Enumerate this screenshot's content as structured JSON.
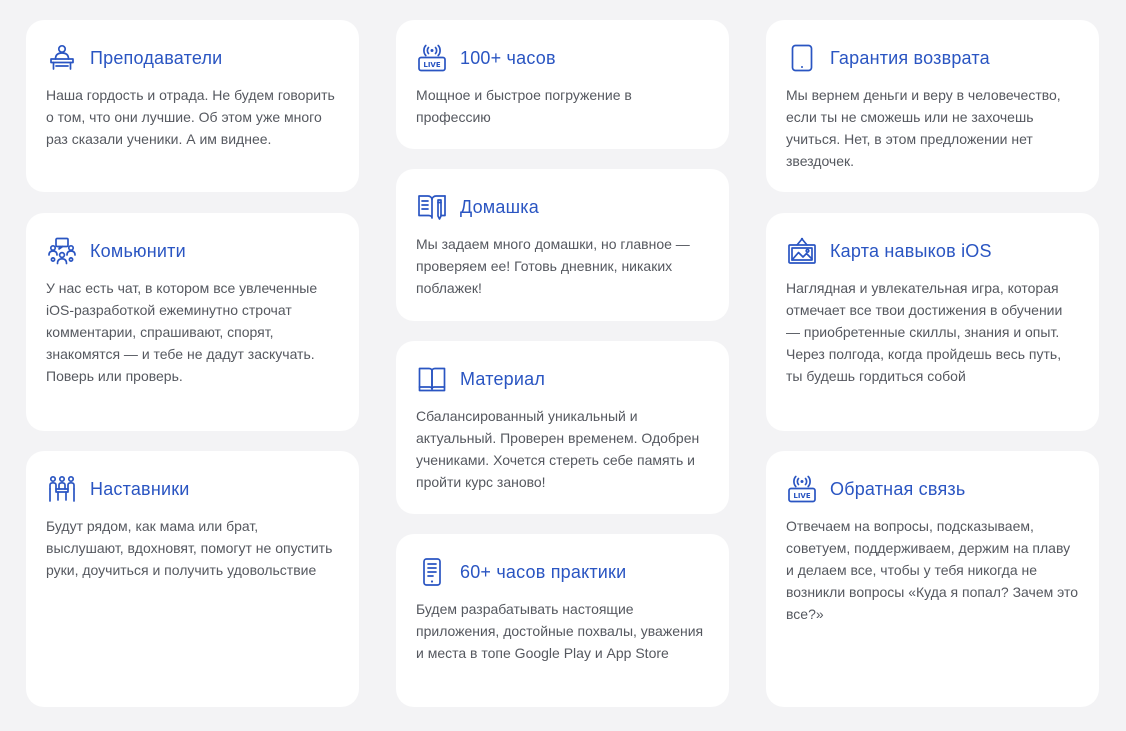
{
  "cards": {
    "teachers": {
      "title": "Преподаватели",
      "text": "Наша гордость и отрада. Не будем говорить о том, что они лучшие. Об этом уже много раз сказали ученики. А им виднее.",
      "icon": "teacher-desk-icon"
    },
    "community": {
      "title": "Комьюнити",
      "text": "У нас есть чат, в котором все увлеченные iOS-разработкой ежеминутно строчат комментарии, спрашивают, спорят, знакомятся — и тебе не дадут заскучать. Поверь или проверь.",
      "icon": "community-icon"
    },
    "mentors": {
      "title": "Наставники",
      "text": "Будут рядом, как мама или брат, выслушают, вдохновят, помогут не опустить руки, доучиться и получить удовольствие",
      "icon": "mentors-icon"
    },
    "hours": {
      "title": "100+ часов",
      "text": "Мощное и быстрое погружение в профессию",
      "icon": "live-broadcast-icon",
      "icon_label": "LIVE"
    },
    "homework": {
      "title": "Домашка",
      "text": "Мы задаем много домашки, но главное — проверяем ее! Готовь дневник, никаких поблажек!",
      "icon": "open-book-pen-icon"
    },
    "material": {
      "title": "Материал",
      "text": "Сбалансированный уникальный и актуальный. Проверен временем. Одобрен учениками. Хочется стереть себе память и пройти курс заново!",
      "icon": "book-icon"
    },
    "practice": {
      "title": "60+ часов практики",
      "text": "Будем разрабатывать настоящие приложения, достойные похвалы, уважения и места в топе Google Play и App Store",
      "icon": "phone-icon"
    },
    "refund": {
      "title": "Гарантия возврата",
      "text": "Мы вернем деньги и веру в человечество, если ты не сможешь или не захочешь учиться. Нет, в этом предложении нет звездочек.",
      "icon": "tablet-icon"
    },
    "skills_map": {
      "title": "Карта навыков iOS",
      "text": "Наглядная и увлекательная игра, которая отмечает все твои достижения в обучении — приобретенные скиллы, знания и опыт. Через полгода, когда пройдешь весь путь, ты будешь гордиться собой",
      "icon": "map-picture-icon"
    },
    "feedback": {
      "title": "Обратная связь",
      "text": "Отвечаем на вопросы, подсказываем, советуем, поддерживаем, держим на плаву и делаем все, чтобы у тебя никогда не возникли вопросы «Куда я попал? Зачем это все?»",
      "icon": "live-broadcast-icon",
      "icon_label": "LIVE"
    }
  },
  "colors": {
    "accent": "#2a55c2",
    "text": "#55585f",
    "background": "#f3f3f5",
    "card": "#ffffff"
  }
}
